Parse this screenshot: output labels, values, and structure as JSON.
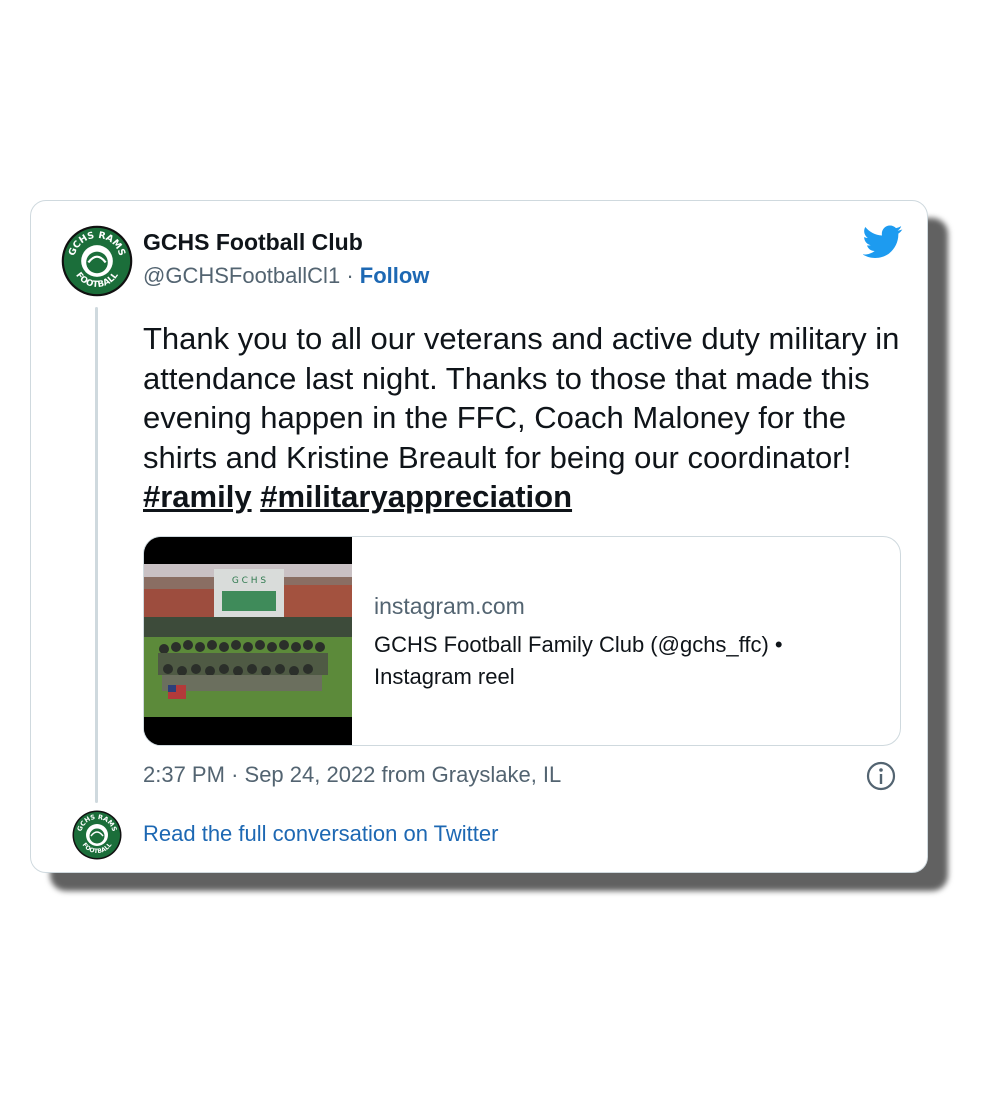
{
  "account": {
    "name": "GCHS Football Club",
    "handle": "@GCHSFootballCl1",
    "separator": "·",
    "follow_label": "Follow",
    "avatar_text_top": "GCHS RAMS",
    "avatar_text_bottom": "FOOTBALL"
  },
  "tweet": {
    "text": "Thank you to all our veterans and active duty military in attendance last night. Thanks to those that made this evening happen in the FFC, Coach Maloney for the shirts and Kristine Breault for being our coordinator!",
    "hashtags": [
      "#ramily",
      "#militaryappreciation"
    ]
  },
  "link_card": {
    "domain": "instagram.com",
    "title": "GCHS Football Family Club (@gchs_ffc) • Instagram reel",
    "thumbnail_icon": "team-photo-image",
    "building_sign": "G C H S"
  },
  "meta": {
    "time": "2:37 PM",
    "separator": "·",
    "date": "Sep 24, 2022",
    "location": "from Grayslake, IL"
  },
  "footer": {
    "read_full_label": "Read the full conversation on Twitter"
  },
  "colors": {
    "text": "#0f1419",
    "secondary": "#536471",
    "link": "#1d68b3",
    "twitter_blue": "#1d9bf0",
    "avatar_green": "#1b6e3a"
  },
  "icons": {
    "brand": "twitter-bird-icon",
    "info": "info-icon"
  }
}
